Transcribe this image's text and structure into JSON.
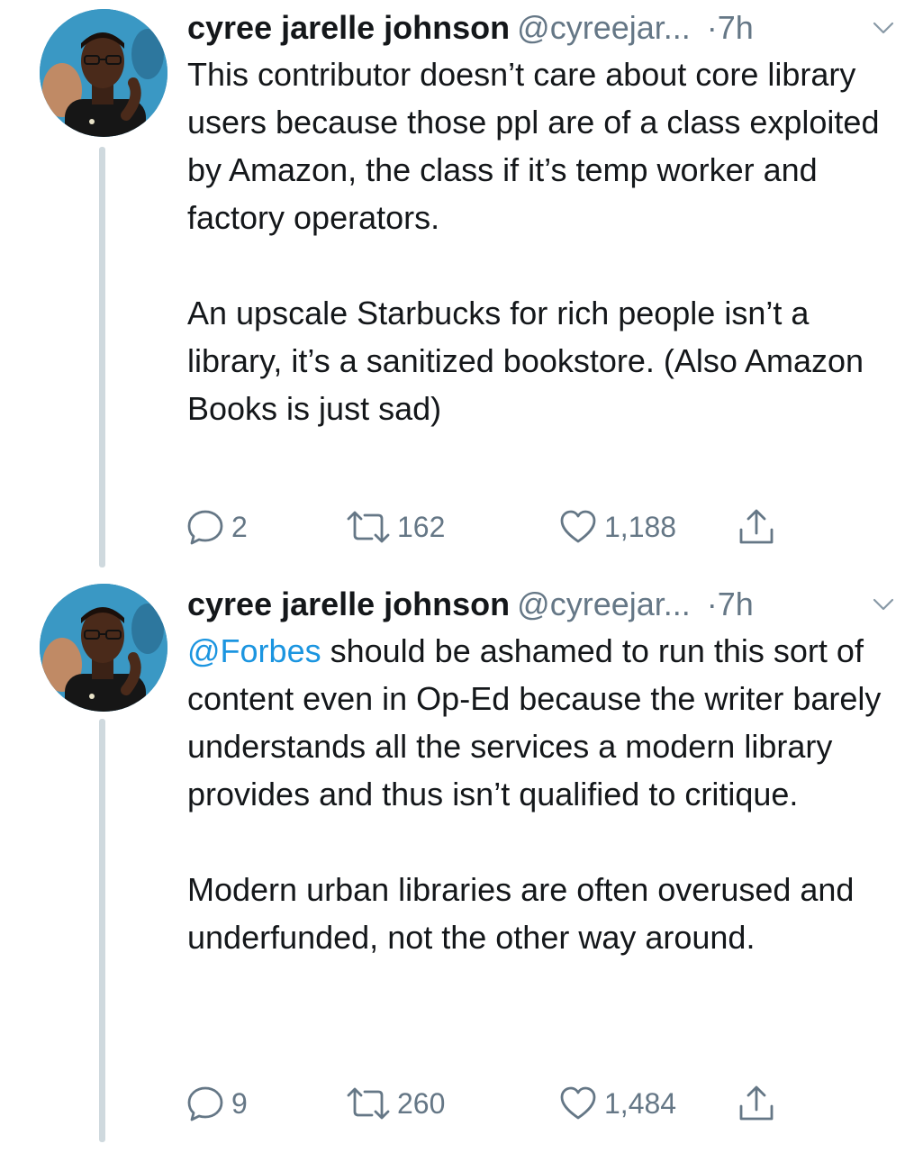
{
  "tweets": [
    {
      "name": "cyree jarelle johnson",
      "handle": "@cyreejar...",
      "separator": "·",
      "time": "7h",
      "mention": "",
      "paragraphs": [
        "This contributor doesn’t care about core library users because those ppl are of a class exploited by Amazon, the class if it’s temp worker and factory operators.",
        "An upscale Starbucks for rich people isn’t a library, it’s a sanitized bookstore. (Also Amazon Books is just sad)"
      ],
      "reply_count": "2",
      "retweet_count": "162",
      "like_count": "1,188"
    },
    {
      "name": "cyree jarelle johnson",
      "handle": "@cyreejar...",
      "separator": "·",
      "time": "7h",
      "mention": "@Forbes",
      "paragraphs": [
        " should be ashamed to run this sort of content even in Op-Ed because the writer barely understands all the services a modern library provides and thus isn’t qualified to critique.",
        "Modern urban libraries are often overused and underfunded, not the other way around."
      ],
      "reply_count": "9",
      "retweet_count": "260",
      "like_count": "1,484"
    }
  ],
  "colors": {
    "text": "#14171a",
    "muted": "#657786",
    "link": "#1b95e0",
    "thread_line": "#cfd9de"
  },
  "icons": {
    "reply": "reply-icon",
    "retweet": "retweet-icon",
    "like": "heart-icon",
    "share": "share-icon",
    "caret": "chevron-down-icon"
  }
}
